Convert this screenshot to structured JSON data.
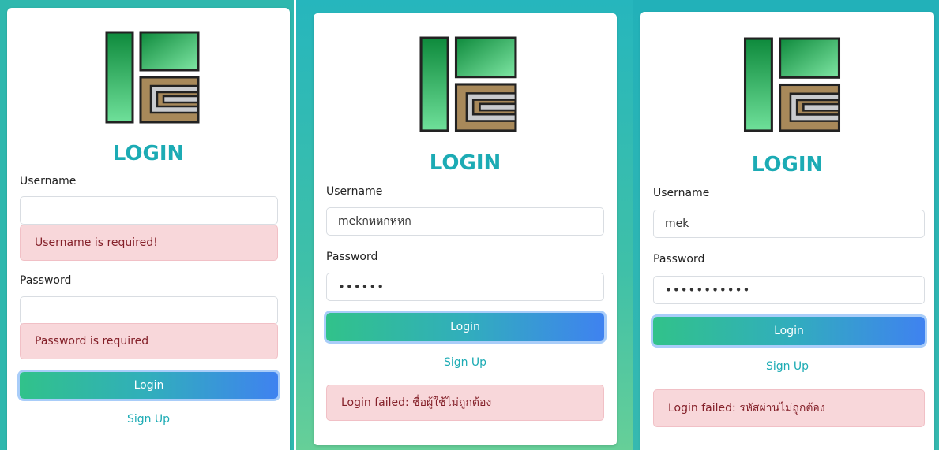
{
  "panels": [
    {
      "title": "LOGIN",
      "username_label": "Username",
      "username_value": "",
      "username_error": "Username is required!",
      "password_label": "Password",
      "password_value": "",
      "password_error": "Password is required",
      "login_button": "Login",
      "signup_link": "Sign Up"
    },
    {
      "title": "LOGIN",
      "username_label": "Username",
      "username_value": "mekกหหกหหก",
      "password_label": "Password",
      "password_value": "••••••",
      "login_button": "Login",
      "signup_link": "Sign Up",
      "login_error": "Login failed: ชื่อผู้ใช้ไม่ถูกต้อง"
    },
    {
      "title": "LOGIN",
      "username_label": "Username",
      "username_value": "mek",
      "password_label": "Password",
      "password_value": "•••••••••••",
      "login_button": "Login",
      "signup_link": "Sign Up",
      "login_error": "Login failed: รหัสผ่านไม่ถูกต้อง"
    }
  ],
  "colors": {
    "accent": "#1cabb4",
    "alert_bg": "#f8d7da",
    "alert_text": "#842029",
    "button_start": "#31c28a",
    "button_end": "#3f82f0"
  },
  "icons": {
    "logo": "company-logo-icon"
  }
}
